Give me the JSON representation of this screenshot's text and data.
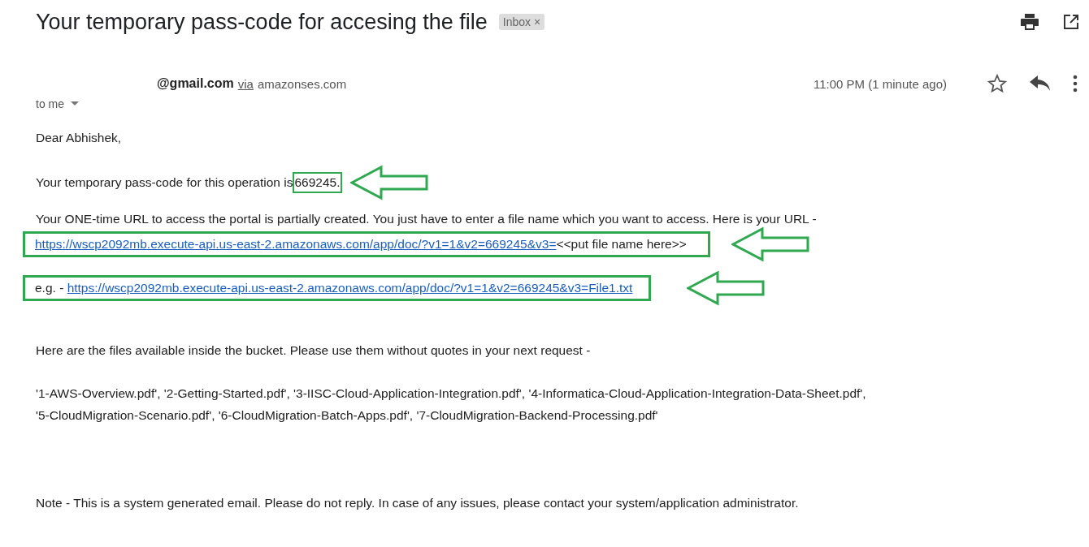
{
  "subject": "Your temporary pass-code for accesing the file",
  "label": {
    "text": "Inbox",
    "close": "×"
  },
  "sender": {
    "address": "@gmail.com",
    "via": "via",
    "domain": "amazonses.com",
    "time": "11:00 PM (1 minute ago)",
    "recipient": "to me"
  },
  "body": {
    "greeting": "Dear Abhishek,",
    "passcode_text": "Your temporary pass-code for this operation is",
    "passcode": "669245.",
    "url_intro": "Your ONE-time URL to access the portal is partially created. You just have to enter a file name which you want to access. Here is your URL -",
    "url_link": "https://wscp2092mb.execute-api.us-east-2.amazonaws.com/app/doc/?v1=1&v2=669245&v3=",
    "url_suffix": "<<put file name here>>",
    "example_prefix": "e.g. -",
    "example_link": "https://wscp2092mb.execute-api.us-east-2.amazonaws.com/app/doc/?v1=1&v2=669245&v3=File1.txt",
    "files_intro": "Here are the files available inside the bucket. Please use them without quotes in your next request -",
    "files_lines": [
      "'1-AWS-Overview.pdf', '2-Getting-Started.pdf', '3-IISC-Cloud-Application-Integration.pdf', '4-Informatica-Cloud-Application-Integration-Data-Sheet.pdf',",
      "'5-CloudMigration-Scenario.pdf', '6-CloudMigration-Batch-Apps.pdf', '7-CloudMigration-Backend-Processing.pdf'"
    ],
    "note": "Note - This is a system generated email. Please do not reply. In case of any issues, please contact your system/application administrator."
  }
}
